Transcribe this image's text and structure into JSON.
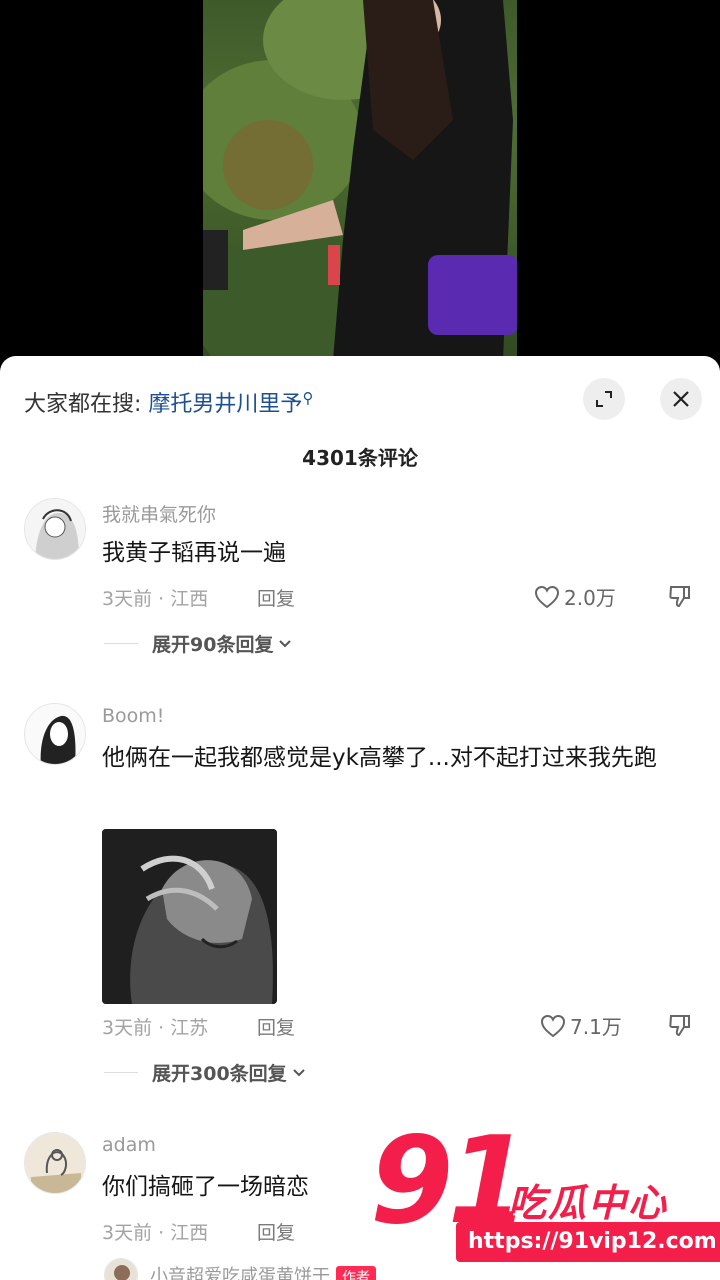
{
  "search": {
    "prefix": "大家都在搜:",
    "term": "摩托男井川里予",
    "icon": "search-icon"
  },
  "header": {
    "comment_count": "4301条评论",
    "expand_icon": "expand-icon",
    "close_icon": "close-icon"
  },
  "comments": [
    {
      "username": "我就串氣死你",
      "text": "我黄子韬再说一遍",
      "time": "3天前",
      "location": "江西",
      "reply_label": "回复",
      "likes": "2.0万",
      "expand_replies": "展开90条回复"
    },
    {
      "username": "Boom!",
      "text": "他俩在一起我都感觉是yk高攀了...对不起打过来我先跑",
      "time": "3天前",
      "location": "江苏",
      "reply_label": "回复",
      "likes": "7.1万",
      "expand_replies": "展开300条回复"
    },
    {
      "username": "adam",
      "text": "你们搞砸了一场暗恋",
      "time": "3天前",
      "location": "江西",
      "reply_label": "回复"
    },
    {
      "username": "小音超爱吃咸蛋黄饼干",
      "badge": "作者"
    }
  ],
  "watermark": {
    "number": "91",
    "name": "吃瓜中心",
    "url": "https://91vip12.com"
  },
  "colors": {
    "accent": "#fe2c55",
    "watermark": "#f31e4a",
    "search_term": "#1d4f91"
  }
}
